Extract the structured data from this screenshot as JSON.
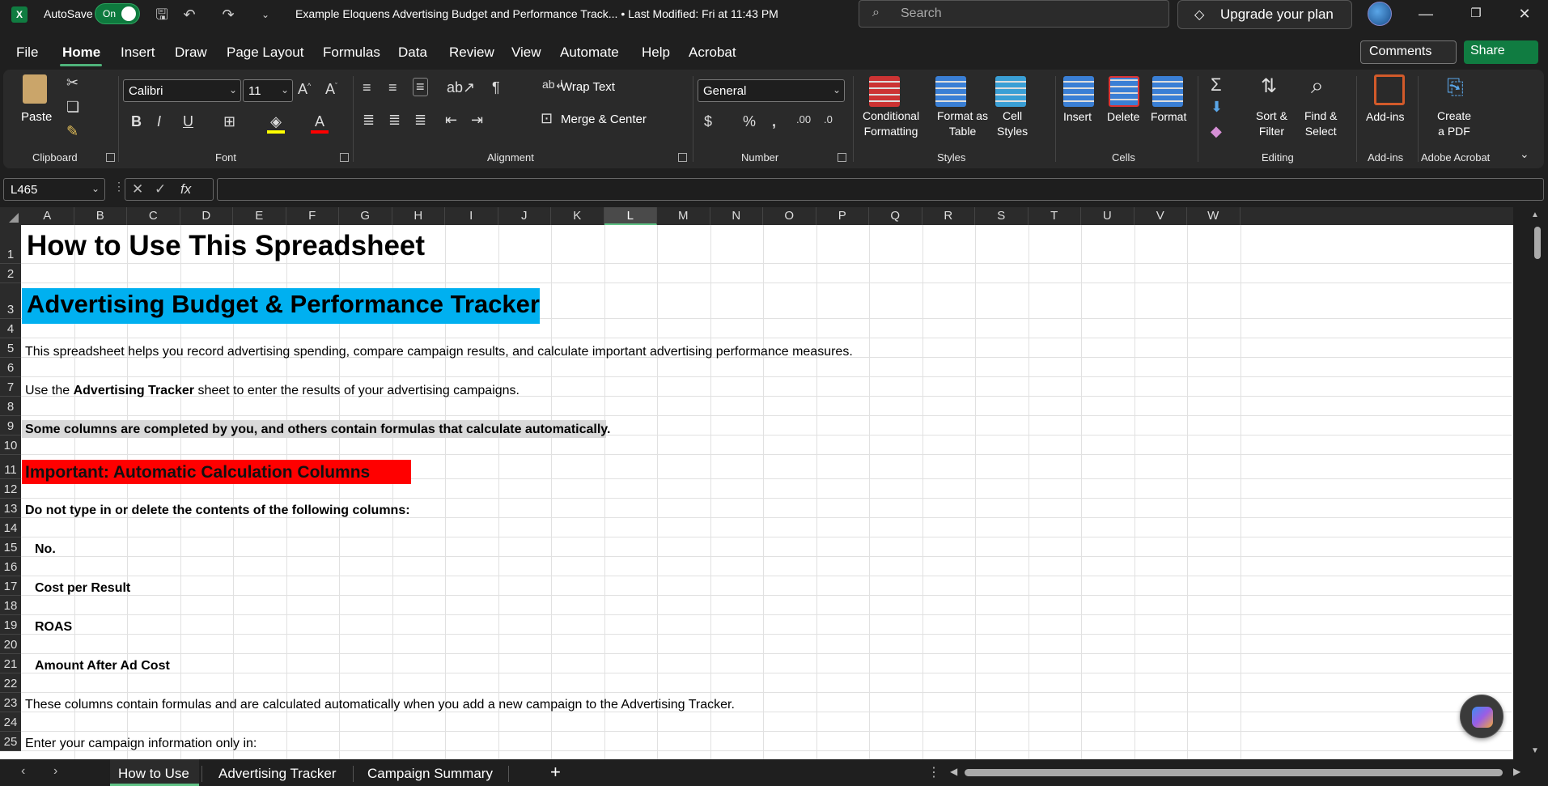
{
  "titlebar": {
    "app_logo": "X",
    "autosave_label": "AutoSave",
    "autosave_state": "On",
    "document_title": "Example Eloquens Advertising Budget and Performance Track...  •  Last Modified: Fri at 11:43 PM",
    "search_placeholder": "Search",
    "upgrade_label": "Upgrade your plan"
  },
  "menu": {
    "items": [
      "File",
      "Home",
      "Insert",
      "Draw",
      "Page Layout",
      "Formulas",
      "Data",
      "Review",
      "View",
      "Automate",
      "Help",
      "Acrobat"
    ],
    "active": "Home",
    "comments_label": "Comments",
    "share_label": "Share"
  },
  "ribbon": {
    "clipboard": {
      "paste": "Paste",
      "group": "Clipboard"
    },
    "font": {
      "name": "Calibri",
      "size": "11",
      "group": "Font"
    },
    "alignment": {
      "wrap_text": "Wrap Text",
      "merge_center": "Merge & Center",
      "group": "Alignment"
    },
    "number": {
      "format": "General",
      "group": "Number"
    },
    "styles": {
      "conditional": "Conditional",
      "formatting": "Formatting",
      "format_as": "Format as",
      "table": "Table",
      "cell": "Cell",
      "styles_label": "Styles",
      "group": "Styles"
    },
    "cells": {
      "insert": "Insert",
      "delete": "Delete",
      "format": "Format",
      "group": "Cells"
    },
    "editing": {
      "sort": "Sort &",
      "filter": "Filter",
      "find": "Find &",
      "select": "Select",
      "group": "Editing"
    },
    "addins": {
      "label": "Add-ins",
      "group": "Add-ins"
    },
    "acrobat": {
      "create": "Create",
      "pdf": "a PDF",
      "group": "Adobe Acrobat"
    }
  },
  "formula_bar": {
    "name_box": "L465",
    "fx": "fx"
  },
  "grid": {
    "columns": [
      "A",
      "B",
      "C",
      "D",
      "E",
      "F",
      "G",
      "H",
      "I",
      "J",
      "K",
      "L",
      "M",
      "N",
      "O",
      "P",
      "Q",
      "R",
      "S",
      "T",
      "U",
      "V",
      "W"
    ],
    "selected_column": "L",
    "rows": [
      "1",
      "2",
      "3",
      "4",
      "5",
      "6",
      "7",
      "8",
      "9",
      "10",
      "11",
      "12",
      "13",
      "14",
      "15",
      "16",
      "17",
      "18",
      "19",
      "20",
      "21",
      "22",
      "23",
      "24",
      "25"
    ],
    "cells": {
      "r1": "How to Use This Spreadsheet",
      "r3": "Advertising Budget & Performance Tracker",
      "r5": "This spreadsheet helps you record advertising spending, compare campaign results, and calculate important advertising performance measures.",
      "r7_pre": "Use the ",
      "r7_bold": "Advertising Tracker",
      "r7_post": " sheet to enter the results of your advertising campaigns.",
      "r9": "Some columns are completed by you, and others contain formulas that calculate automatically.",
      "r11": "Important: Automatic Calculation Columns",
      "r13": "Do not type in or delete the contents of the following columns:",
      "r15": "No.",
      "r17": "Cost per Result",
      "r19": "ROAS",
      "r21": "Amount After Ad Cost",
      "r23": "These columns contain formulas and are calculated automatically when you add a new campaign to the Advertising Tracker.",
      "r25": "Enter your campaign information only in:"
    },
    "colors": {
      "title_band": "#00b0f0",
      "important_band": "#ff0000",
      "highlight_band": "#d9d9d9"
    }
  },
  "tabs": {
    "items": [
      "How to Use",
      "Advertising Tracker",
      "Campaign Summary"
    ],
    "active": "How to Use",
    "add": "+"
  }
}
